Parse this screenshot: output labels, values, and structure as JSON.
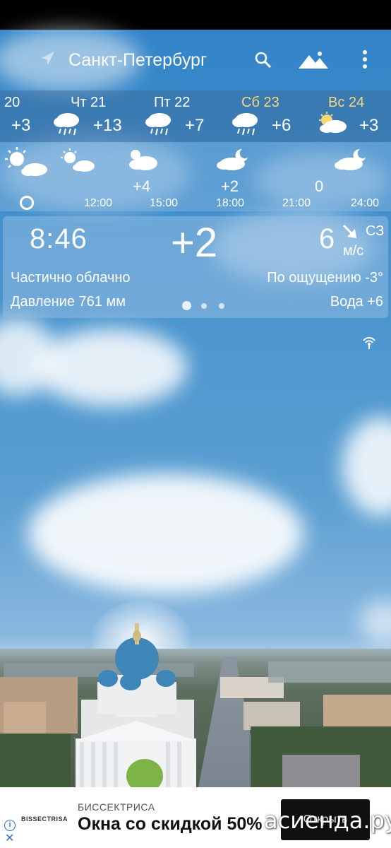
{
  "header": {
    "city": "Санкт-Петербург",
    "icons": [
      "location-arrow-icon",
      "search-icon",
      "mountain-icon",
      "more-vert-icon"
    ]
  },
  "daily": [
    {
      "label": "20",
      "temp": "+3",
      "icon": "rain-cloud-icon",
      "color": "#ffffff"
    },
    {
      "label": "Чт 21",
      "temp": "+13",
      "icon": "rain-cloud-icon",
      "color": "#ffffff"
    },
    {
      "label": "Пт 22",
      "temp": "+7",
      "icon": "rain-cloud-icon",
      "color": "#ffffff"
    },
    {
      "label": "Сб 23",
      "temp": "+6",
      "icon": "rain-cloud-icon",
      "color": "#f5d77a"
    },
    {
      "label": "Вс 24",
      "temp": "+3",
      "icon": "sun-cloud-icon",
      "color": "#f5d77a"
    }
  ],
  "hourly": {
    "items": [
      {
        "time": "12:00",
        "temp": "",
        "icon": "sun-cloud-icon"
      },
      {
        "time": "15:00",
        "temp": "+4",
        "icon": "cloud-icon"
      },
      {
        "time": "18:00",
        "temp": "+2",
        "icon": "moon-cloud-icon"
      },
      {
        "time": "21:00",
        "temp": "0",
        "icon": ""
      },
      {
        "time": "24:00",
        "temp": "",
        "icon": "moon-cloud-icon"
      }
    ]
  },
  "current": {
    "time": "8:46",
    "temp": "+2",
    "wind_speed": "6",
    "wind_dir": "СЗ",
    "wind_unit": "м/с",
    "condition": "Частично облачно",
    "feels_like": "По ощущению -3°",
    "pressure": "Давление 761 мм",
    "water": "Вода +6",
    "page_index": 0,
    "page_count": 3
  },
  "ad": {
    "logo": "BISSECTRISA",
    "brand": "БИССЕКТРИСА",
    "headline": "Окна со скидкой 50%",
    "button": "Открыть"
  },
  "watermark": "асиенда.ру",
  "colors": {
    "weekend": "#f5d77a",
    "sky": "#4390cd",
    "ad_button": "#111111"
  }
}
